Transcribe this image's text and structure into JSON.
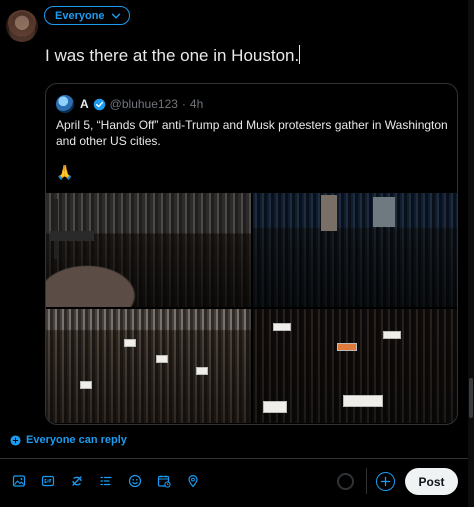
{
  "composer": {
    "audience_label": "Everyone",
    "text": "I was there at the one in Houston."
  },
  "quote": {
    "name": "A",
    "handle": "@bluhue123",
    "separator": "·",
    "time": "4h",
    "text": "April 5, “Hands Off” anti-Trump and Musk protesters gather in Washington and other US cities.",
    "emoji": "🙏"
  },
  "reply_setting": {
    "label": "Everyone can reply"
  },
  "toolbar": {
    "icons": [
      "image-icon",
      "gif-icon",
      "grok-icon",
      "poll-icon",
      "emoji-icon",
      "schedule-icon",
      "location-icon"
    ],
    "post_label": "Post"
  },
  "colors": {
    "accent": "#1d9bf0",
    "background": "#000000",
    "border": "#2f3336",
    "post_button": "#eff3f4"
  }
}
